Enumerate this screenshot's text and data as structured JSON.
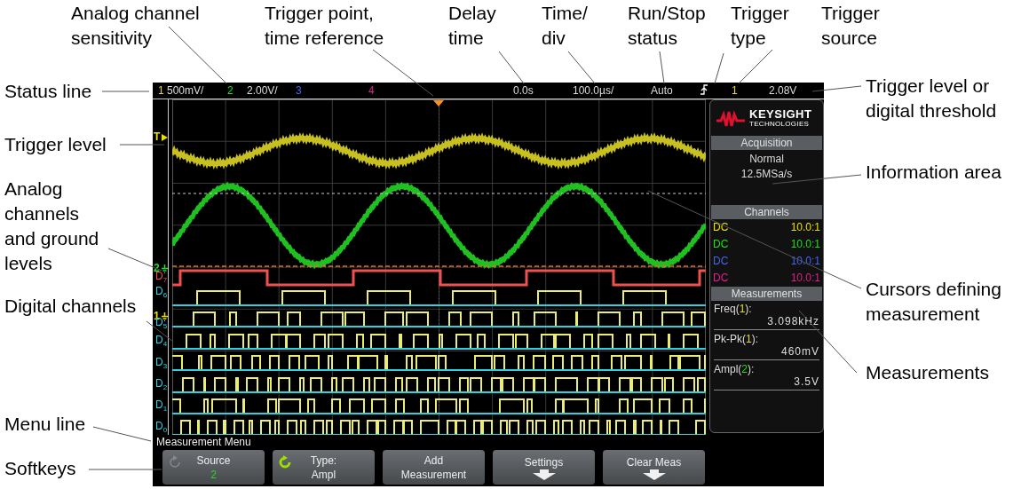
{
  "callouts": [
    {
      "text": "Analog channel sensitivity"
    },
    {
      "text": "Trigger point, time reference"
    },
    {
      "text": "Delay time"
    },
    {
      "text": "Time/ div"
    },
    {
      "text": "Run/Stop status"
    },
    {
      "text": "Trigger type"
    },
    {
      "text": "Trigger source"
    },
    {
      "text": "Status line"
    },
    {
      "text": "Trigger level"
    },
    {
      "text": "Analog channels and ground levels"
    },
    {
      "text": "Digital channels"
    },
    {
      "text": "Menu line"
    },
    {
      "text": "Softkeys"
    },
    {
      "text": "Trigger level or digital threshold"
    },
    {
      "text": "Information area"
    },
    {
      "text": "Cursors defining measurement"
    },
    {
      "text": "Measurements"
    }
  ],
  "status_line": [
    {
      "kind": "channel",
      "text": "1",
      "color": "#e8e000"
    },
    {
      "kind": "value",
      "text": "500mV/"
    },
    {
      "kind": "channel",
      "text": "2",
      "color": "#22dd22"
    },
    {
      "kind": "value",
      "text": "2.00V/"
    },
    {
      "kind": "channel",
      "text": "3",
      "color": "#4466ee"
    },
    {
      "kind": "channel",
      "text": "4",
      "color": "#e0208a"
    },
    {
      "kind": "value",
      "text": "0.0s"
    },
    {
      "kind": "value",
      "text": "100.0µs/"
    },
    {
      "kind": "value",
      "text": "Auto"
    },
    {
      "kind": "trigger-edge"
    },
    {
      "kind": "channel",
      "text": "1",
      "color": "#e8e000"
    },
    {
      "kind": "value",
      "text": "2.08V"
    }
  ],
  "display": {
    "markers": [
      {
        "kind": "trigger",
        "text": "T",
        "color": "#e8e000"
      },
      {
        "kind": "ground",
        "text": "2",
        "color": "#22dd22"
      },
      {
        "kind": "ground",
        "text": "1",
        "color": "#e8e000"
      }
    ],
    "digital_labels": [
      {
        "text": "D$_{7}$",
        "color": "#f05050"
      },
      {
        "text": "D$_{6}$",
        "color": "#30d0e0"
      },
      {
        "text": "D$_{5}$",
        "color": "#30d0e0"
      },
      {
        "text": "D$_{4}$",
        "color": "#30d0e0"
      },
      {
        "text": "D$_{3}$",
        "color": "#30d0e0"
      },
      {
        "text": "D$_{2}$",
        "color": "#30d0e0"
      },
      {
        "text": "D$_{1}$",
        "color": "#30d0e0"
      },
      {
        "text": "D$_{0}$",
        "color": "#30d0e0"
      }
    ]
  },
  "info_panel": {
    "logo": {
      "name": "KEYSIGHT",
      "subtitle": "TECHNOLOGIES"
    },
    "acquisition": {
      "title": "Acquisition",
      "mode": "Normal",
      "rate": "12.5MSa/s"
    },
    "channels": {
      "title": "Channels",
      "rows": [
        {
          "coupling": "DC",
          "probe": "10.0:1",
          "color": "#e8e000"
        },
        {
          "coupling": "DC",
          "probe": "10.0:1",
          "color": "#22dd22"
        },
        {
          "coupling": "DC",
          "probe": "10.0:1",
          "color": "#4466ee"
        },
        {
          "coupling": "DC",
          "probe": "10.0:1",
          "color": "#e0208a"
        }
      ]
    },
    "measurements": {
      "title": "Measurements",
      "items": [
        {
          "name": "Freq(",
          "source": "1",
          "suffix": "):",
          "color": "#e8e000",
          "value": "3.098kHz"
        },
        {
          "name": "Pk-Pk(",
          "source": "1",
          "suffix": "):",
          "color": "#e8e000",
          "value": "460mV"
        },
        {
          "name": "Ampl(",
          "source": "2",
          "suffix": "):",
          "color": "#22dd22",
          "value": "3.5V"
        }
      ]
    }
  },
  "menu_line": "Measurement Menu",
  "softkeys": [
    {
      "kind": "knob",
      "label": "Source",
      "value": "2",
      "knob_active": false,
      "color": "#22dd22"
    },
    {
      "kind": "knob",
      "label": "Type:",
      "value": "Ampl",
      "knob_active": true
    },
    {
      "kind": "text",
      "label": "Add",
      "value": "Measurement"
    },
    {
      "kind": "submenu",
      "label": "Settings"
    },
    {
      "kind": "submenu",
      "label": "Clear Meas"
    }
  ]
}
